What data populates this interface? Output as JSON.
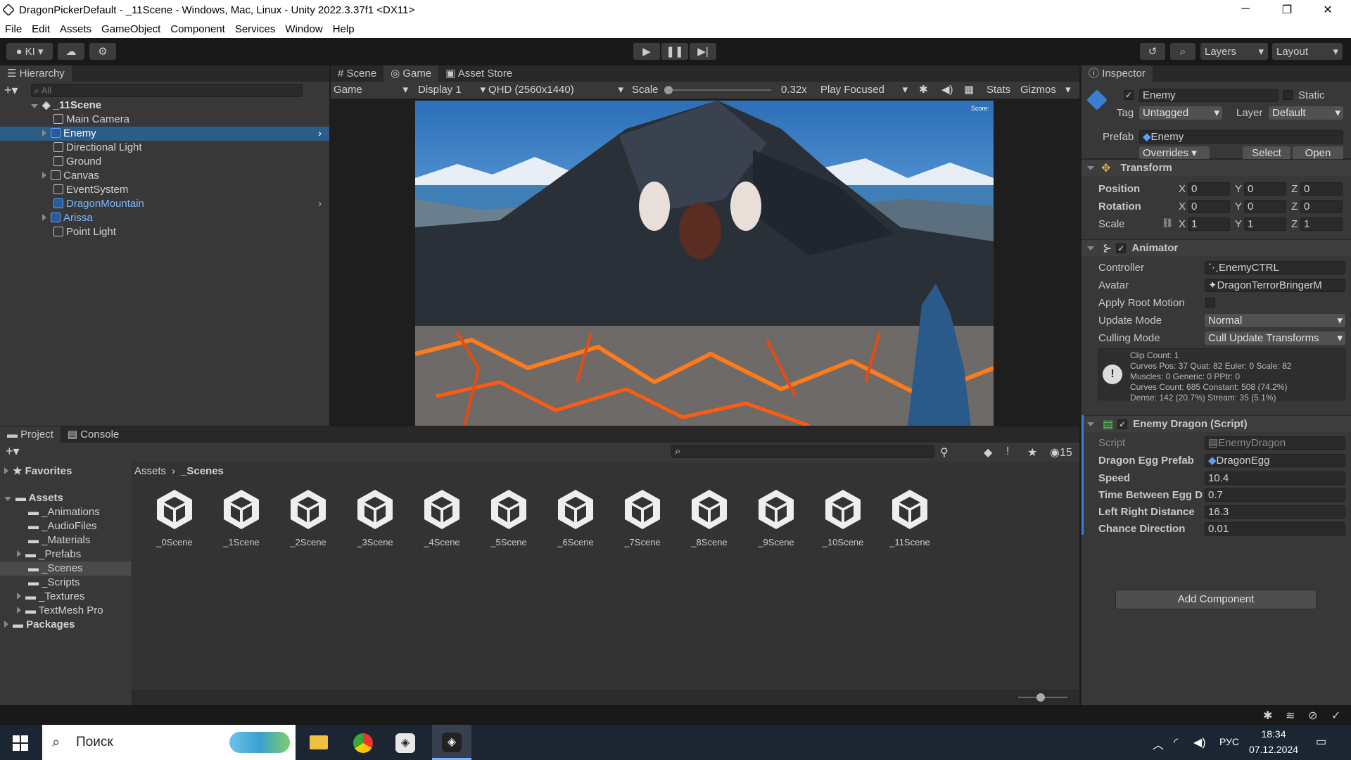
{
  "window": {
    "title": "DragonPickerDefault - _11Scene - Windows, Mac, Linux - Unity 2022.3.37f1 <DX11>",
    "minimize": "─",
    "maximize": "❐",
    "close": "✕"
  },
  "menu": [
    "File",
    "Edit",
    "Assets",
    "GameObject",
    "Component",
    "Services",
    "Window",
    "Help"
  ],
  "toolbar": {
    "account": "KI",
    "layers": "Layers",
    "layout": "Layout"
  },
  "hierarchy": {
    "tab": "Hierarchy",
    "search_placeholder": "All",
    "scene": "_11Scene",
    "items": [
      {
        "label": "Main Camera"
      },
      {
        "label": "Enemy"
      },
      {
        "label": "Directional Light"
      },
      {
        "label": "Ground"
      },
      {
        "label": "Canvas"
      },
      {
        "label": "EventSystem"
      },
      {
        "label": "DragonMountain"
      },
      {
        "label": "Arissa"
      },
      {
        "label": "Point Light"
      }
    ]
  },
  "game_view": {
    "tabs": [
      "Scene",
      "Game",
      "Asset Store"
    ],
    "mode": "Game",
    "display": "Display 1",
    "resolution": "QHD (2560x1440)",
    "scale_label": "Scale",
    "scale_value": "0.32x",
    "play_focused": "Play Focused",
    "stats": "Stats",
    "gizmos": "Gizmos",
    "score_label": "Score:"
  },
  "project": {
    "tabs": [
      "Project",
      "Console"
    ],
    "favorites": "Favorites",
    "assets": "Assets",
    "folders": [
      "_Animations",
      "_AudioFiles",
      "_Materials",
      "_Prefabs",
      "_Scenes",
      "_Scripts",
      "_Textures",
      "TextMesh Pro"
    ],
    "packages": "Packages",
    "breadcrumb_root": "Assets",
    "breadcrumb_current": "_Scenes",
    "hidden_count": "15",
    "scenes": [
      "_0Scene",
      "_1Scene",
      "_2Scene",
      "_3Scene",
      "_4Scene",
      "_5Scene",
      "_6Scene",
      "_7Scene",
      "_8Scene",
      "_9Scene",
      "_10Scene",
      "_11Scene"
    ]
  },
  "inspector": {
    "tab": "Inspector",
    "name": "Enemy",
    "static": "Static",
    "tag_label": "Tag",
    "tag": "Untagged",
    "layer_label": "Layer",
    "layer": "Default",
    "prefab_label": "Prefab",
    "prefab": "Enemy",
    "overrides": "Overrides",
    "select": "Select",
    "open": "Open",
    "transform": {
      "title": "Transform",
      "position": "Position",
      "rotation": "Rotation",
      "scale": "Scale",
      "px": "0",
      "py": "0",
      "pz": "0",
      "rx": "0",
      "ry": "0",
      "rz": "0",
      "sx": "1",
      "sy": "1",
      "sz": "1",
      "x": "X",
      "y": "Y",
      "z": "Z"
    },
    "animator": {
      "title": "Animator",
      "controller_label": "Controller",
      "controller": "EnemyCTRL",
      "avatar_label": "Avatar",
      "avatar": "DragonTerrorBringerM",
      "apply_root_motion": "Apply Root Motion",
      "update_mode_label": "Update Mode",
      "update_mode": "Normal",
      "culling_mode_label": "Culling Mode",
      "culling_mode": "Cull Update Transforms",
      "info": [
        "Clip Count: 1",
        "Curves Pos: 37 Quat: 82 Euler: 0 Scale: 82",
        "Muscles: 0 Generic: 0 PPtr: 0",
        "Curves Count: 685 Constant: 508 (74.2%)",
        "Dense: 142 (20.7%) Stream: 35 (5.1%)"
      ]
    },
    "script": {
      "title": "Enemy Dragon (Script)",
      "script_label": "Script",
      "script": "EnemyDragon",
      "egg_label": "Dragon Egg Prefab",
      "egg": "DragonEgg",
      "speed_label": "Speed",
      "speed": "10.4",
      "time_label": "Time Between Egg D",
      "time": "0.7",
      "lr_label": "Left Right Distance",
      "lr": "16.3",
      "chance_label": "Chance Direction",
      "chance": "0.01"
    },
    "add_component": "Add Component"
  },
  "taskbar": {
    "search": "Поиск",
    "lang": "РУС",
    "time": "18:34",
    "date": "07.12.2024"
  }
}
